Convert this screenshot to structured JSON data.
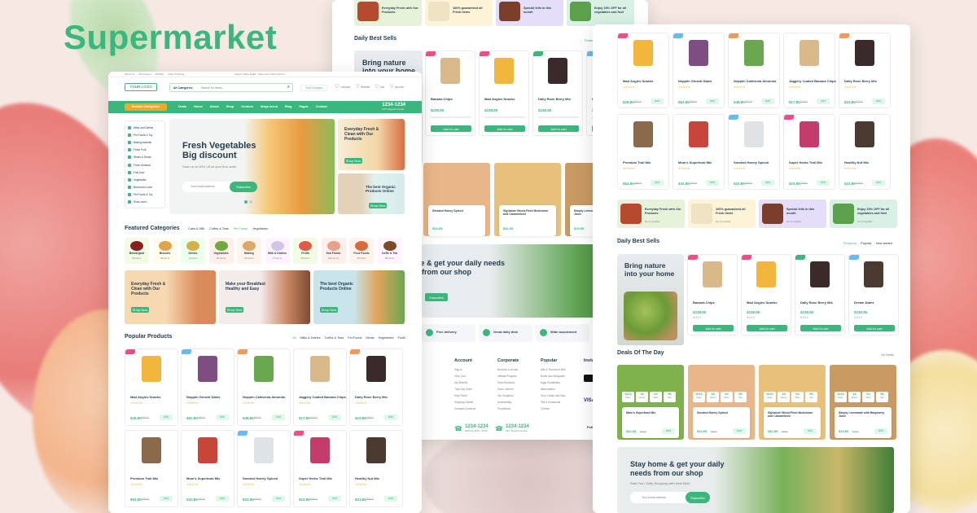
{
  "headline": "Supermarket",
  "colors": {
    "brand": "#3bb77e",
    "accent": "#fdc040",
    "hot": "#f74b81",
    "new": "#67bcee",
    "sale": "#f59758",
    "dark": "#253d4e"
  },
  "front": {
    "topbar_links": [
      "About Us",
      "My Account",
      "Wishlist",
      "Order Tracking"
    ],
    "topbar_center": "Supper Value Deals - Save more with coupons",
    "logo": "YOUR LOGO",
    "search": {
      "category": "All Categories",
      "placeholder": "Search for items..."
    },
    "location": "Your Location",
    "header_icons": [
      "Compare",
      "Wishlist",
      "Cart",
      "Account"
    ],
    "nav": {
      "browse": "Browse Categories",
      "items": [
        "Deals",
        "Home",
        "About",
        "Shop",
        "Vendors",
        "Mega menu",
        "Blog",
        "Pages",
        "Contact"
      ],
      "phone": "1234-1234",
      "phone_sub": "24/7 Support Center"
    },
    "sidebar_cats": [
      "Milks and Dairies",
      "Pet Foods & Toy",
      "Baking material",
      "Fresh Fruit",
      "Wines & Drinks",
      "Fresh Seafood",
      "Fast food",
      "Vegetables",
      "Bread and Juice",
      "Pet Foods & Toy",
      "Show more..."
    ],
    "hero": {
      "title": "Fresh Vegetables Big discount",
      "subtitle": "Save up to 50% off on your first order",
      "email_placeholder": "Your email address",
      "button": "Subscribe"
    },
    "side_banners": [
      {
        "title": "Everyday Fresh & Clean with Our Products",
        "button": "Shop Now"
      },
      {
        "title": "The best Organic Products Online",
        "button": "Shop Now"
      }
    ],
    "featured": {
      "title": "Featured Categories",
      "tabs": [
        "Cake & Milk",
        "Coffes & Teas",
        "Pet Foods",
        "Vegetables"
      ],
      "items": [
        {
          "name": "Beteargard",
          "count": "26 items"
        },
        {
          "name": "Biscuits",
          "count": "28 items"
        },
        {
          "name": "Drinks",
          "count": "14 items"
        },
        {
          "name": "Vegetables",
          "count": "56 items"
        },
        {
          "name": "Baking",
          "count": "26 items"
        },
        {
          "name": "Milk & Dairies",
          "count": "72 items"
        },
        {
          "name": "Fruits",
          "count": "36 items"
        },
        {
          "name": "Sea Foods",
          "count": "124 items"
        },
        {
          "name": "Four Foods",
          "count": "39 items"
        },
        {
          "name": "Coffe & Tea",
          "count": "85 items"
        }
      ]
    },
    "mid_banners": [
      {
        "title": "Everyday Fresh & Clean with Our Products",
        "button": "Shop Now"
      },
      {
        "title": "Make your Breakfast Healthy and Easy",
        "button": "Shop Now"
      },
      {
        "title": "The best Organic Products Online",
        "button": "Shop Now"
      }
    ],
    "popular": {
      "title": "Popular Products",
      "tabs": [
        "All",
        "Milks & Dairies",
        "Coffes & Teas",
        "Pet Foods",
        "Meats",
        "Vegetables",
        "Fruits"
      ]
    },
    "products_row1": [
      {
        "name": "Mad Angles Snacks",
        "price": "$28.85",
        "old": "$32.8",
        "tag": "hot"
      },
      {
        "name": "Nepplin Ginseti Dates",
        "price": "$52.85",
        "old": "$55.8",
        "tag": "new"
      },
      {
        "name": "Nepplin California Almonds",
        "price": "$48.85",
        "old": "$52.8",
        "tag": "sale"
      },
      {
        "name": "Jaggery Coated Banana Chips",
        "price": "$17.85",
        "old": "$19.8",
        "tag": ""
      },
      {
        "name": "Daily Rose Berry Mix",
        "price": "$23.85",
        "old": "$25.8",
        "tag": "sale"
      }
    ],
    "products_row2": [
      {
        "name": "Premium Trail Mix",
        "price": "$54.85",
        "old": "$55.8",
        "tag": ""
      },
      {
        "name": "Mom's Superfood Mix",
        "price": "$32.85",
        "old": "$33.8",
        "tag": ""
      },
      {
        "name": "Smoked Honey Spiced",
        "price": "$23.85",
        "old": "$25.8",
        "tag": "new"
      },
      {
        "name": "Super Herbs Trail Mix",
        "price": "$23.85",
        "old": "$25.8",
        "tag": "hot"
      },
      {
        "name": "Healthy Nut Mix",
        "price": "$23.85",
        "old": "$25.8",
        "tag": ""
      }
    ],
    "add_label": "Add"
  },
  "back": {
    "banners": [
      "Everyday Fresh with Our Products",
      "100% guaranteed all Fresh items",
      "Special fells in this month",
      "Enjoy 15% OFF for all vegetables and fruit"
    ],
    "daily_title": "Daily Best Sells",
    "daily_tab": "Featured",
    "side_promo": "Bring nature into your home",
    "daily_products": [
      {
        "name": "Banana Chips",
        "price": "$238.85"
      },
      {
        "name": "Mad Angles Snacks",
        "price": "$238.85"
      },
      {
        "name": "Daily Rose Berry Mix",
        "price": "$238.85"
      },
      {
        "name": "Dream Dates",
        "price": "$238.85"
      }
    ],
    "add_to_cart": "Add to cart",
    "deals": [
      {
        "name": "Smoked Honey Spiced",
        "price": "$34.85"
      },
      {
        "name": "Signature Wood-Fired Mushroom and Caramelized",
        "price": "$52.85"
      },
      {
        "name": "Simply Lemonade with Raspberry Juice",
        "price": "$19.85"
      }
    ],
    "newsletter": "Stay home & get your daily needs from our shop",
    "subscribe": "Subscribe",
    "features": [
      "Free delivery",
      "Great daily deal",
      "Wide assortment"
    ],
    "footer_cols": [
      {
        "title": "Account",
        "items": [
          "Sign In",
          "View Cart",
          "My Wishlist",
          "Track My Order",
          "Help Ticket",
          "Shipping Details",
          "Compare products"
        ]
      },
      {
        "title": "Corporate",
        "items": [
          "Become a Vendor",
          "Affiliate Program",
          "Farm Business",
          "Farm Careers",
          "Our Suppliers",
          "Accessibility",
          "Promotions"
        ]
      },
      {
        "title": "Popular",
        "items": [
          "Milk & Flavoured Milk",
          "Butter and Margarine",
          "Eggs Substitutes",
          "Marmalades",
          "Sour Cream and Dips",
          "Tea & Kombucha",
          "Cheese"
        ]
      },
      {
        "title": "Install App",
        "items": []
      }
    ],
    "phones": [
      {
        "num": "1234-1234",
        "sub": "Working 8:00 - 22:00"
      },
      {
        "num": "1234-1234",
        "sub": "24/7 Support Center"
      }
    ],
    "follow": "Follow"
  },
  "right": {
    "row1": [
      {
        "name": "Mad Angles Snacks",
        "price": "$28.85",
        "old": "$32.8",
        "tag": "hot"
      },
      {
        "name": "Nepplin Ginseti Dates",
        "price": "$52.85",
        "old": "$55.8",
        "tag": "new"
      },
      {
        "name": "Nepplin California Almonds",
        "price": "$48.85",
        "old": "$52.8",
        "tag": "sale"
      },
      {
        "name": "Jaggery Coated Banana Chips",
        "price": "$17.85",
        "old": "$19.8",
        "tag": ""
      },
      {
        "name": "Daily Rose Berry Mix",
        "price": "$23.85",
        "old": "$25.8",
        "tag": "sale"
      }
    ],
    "row2": [
      {
        "name": "Premium Trail Mix",
        "price": "$54.85",
        "old": "$55.8",
        "tag": ""
      },
      {
        "name": "Mom's Superfood Mix",
        "price": "$32.85",
        "old": "$33.8",
        "tag": ""
      },
      {
        "name": "Smoked Honey Spiced",
        "price": "$23.85",
        "old": "$25.8",
        "tag": "new"
      },
      {
        "name": "Super Herbs Trail Mix",
        "price": "$23.85",
        "old": "$25.8",
        "tag": "hot"
      },
      {
        "name": "Healthy Nut Mix",
        "price": "$23.85",
        "old": "$25.8",
        "tag": ""
      }
    ],
    "banners": [
      "Everyday Fresh with Our Products",
      "100% guaranteed all Fresh items",
      "Special fells in this month",
      "Enjoy 15% OFF for all vegetables and fruit"
    ],
    "banner_sub": "Go to supplier",
    "daily_title": "Daily Best Sells",
    "daily_tabs": [
      "Featured",
      "Popular",
      "New added"
    ],
    "side_promo": "Bring nature into your home",
    "daily_products": [
      {
        "name": "Banana Chips",
        "price": "$238.85",
        "old": "$245.8"
      },
      {
        "name": "Mad Angles Snacks",
        "price": "$238.85",
        "old": "$245.8"
      },
      {
        "name": "Daily Rose Berry Mix",
        "price": "$238.85",
        "old": "$245.8"
      },
      {
        "name": "Dream Dates",
        "price": "$238.85",
        "old": "$245.8"
      }
    ],
    "add_to_cart": "Add to cart",
    "deals_title": "Deals Of The Day",
    "deals_all": "All Deals",
    "deals": [
      {
        "name": "Mom's Superfood Mix",
        "price": "$32.85",
        "old": "$33.8"
      },
      {
        "name": "Smoked Honey Spiced",
        "price": "$34.85",
        "old": "$35.8"
      },
      {
        "name": "Signature Wood-Fired Mushroom and Caramelized",
        "price": "$52.85",
        "old": "$55.8"
      },
      {
        "name": "Simply Lemonade with Raspberry Juice",
        "price": "$19.85",
        "old": "$21.8"
      }
    ],
    "countdown": [
      "1021",
      "Days",
      "18",
      "Hours",
      "04",
      "Mins",
      "56",
      "Sec"
    ],
    "newsletter": "Stay home & get your daily needs from our shop",
    "newsletter_sub": "Start You'r Daily Shopping with Nest Mart",
    "email_placeholder": "Your email address",
    "subscribe": "Subscribe"
  }
}
